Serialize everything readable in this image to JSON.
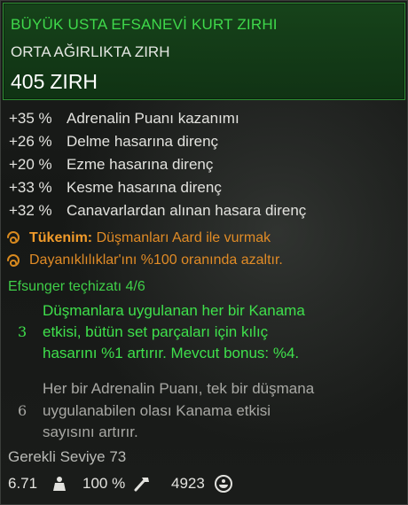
{
  "item": {
    "name": "BÜYÜK USTA EFSANEVİ KURT ZIRHI",
    "type": "ORTA AĞIRLIKTA ZIRH",
    "armor_value": "405",
    "armor_label": "ZIRH"
  },
  "stats": [
    {
      "value": "+35 %",
      "label": "Adrenalin Puanı kazanımı"
    },
    {
      "value": "+26 %",
      "label": "Delme hasarına direnç"
    },
    {
      "value": "+20 %",
      "label": "Ezme hasarına direnç"
    },
    {
      "value": "+33 %",
      "label": "Kesme hasarına direnç"
    },
    {
      "value": "+32 %",
      "label": "Canavarlardan alınan hasara direnç"
    }
  ],
  "exhausted": {
    "title": "Tükenim:",
    "line1": "Düşmanları Aard ile vurmak",
    "line2": "Dayanıklılıklar'ını %100 oranında azaltır.",
    "icon": "swirl-icon"
  },
  "set": {
    "title": "Efsunger teçhizatı 4/6",
    "bonuses": [
      {
        "count": "3",
        "active": true,
        "lines": [
          "Düşmanlara uygulanan her bir Kanama",
          "etkisi, bütün set parçaları için kılıç",
          "hasarını %1 artırır. Mevcut bonus: %4."
        ]
      },
      {
        "count": "6",
        "active": false,
        "lines": [
          "Her bir Adrenalin Puanı, tek bir düşmana",
          "uygulanabilen olası Kanama etkisi",
          "sayısını artırır."
        ]
      }
    ]
  },
  "required_level": "Gerekli Seviye 73",
  "footer": {
    "weight": "6.71",
    "weight_icon": "weight-icon",
    "durability": "100 %",
    "durability_icon": "hammer-icon",
    "price": "4923",
    "price_icon": "coin-icon"
  },
  "colors": {
    "set_active": "#3fe04c",
    "set_inactive": "#a8a8a4",
    "exhausted": "#e08b26",
    "header_bg": "#164a1a"
  }
}
